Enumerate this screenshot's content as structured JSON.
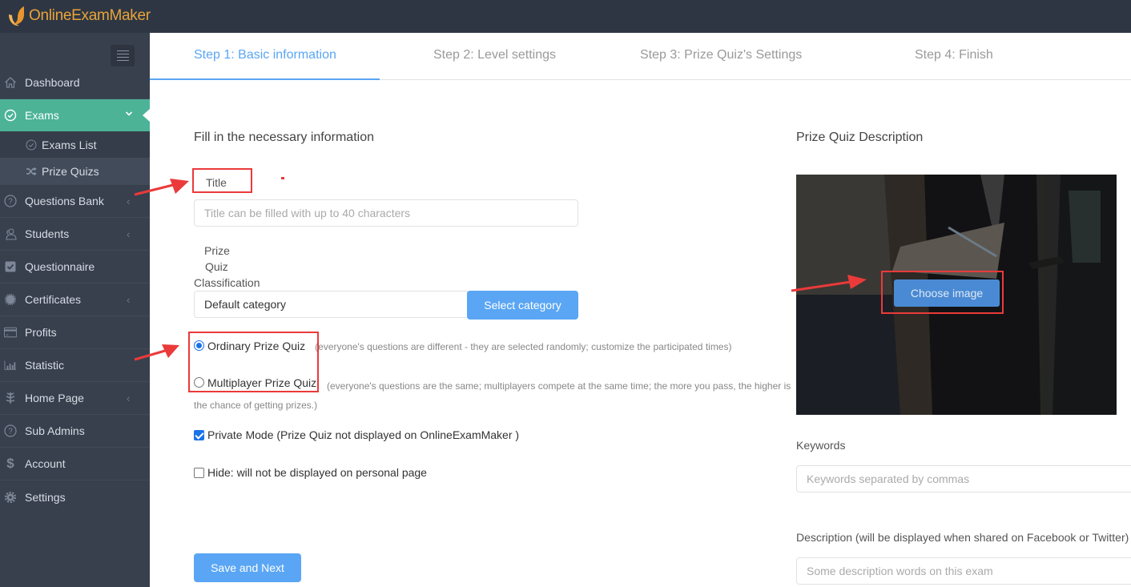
{
  "app": {
    "brand": "OnlineExamMaker",
    "accent_color": "#4cb397",
    "primary_color": "#5aa6f4"
  },
  "sidebar": {
    "toggle_icon": "hamburger-icon",
    "items": [
      {
        "label": "Dashboard",
        "icon": "home-icon",
        "has_chevron": false
      },
      {
        "label": "Exams",
        "icon": "check-circle-icon",
        "has_chevron": true,
        "active": true,
        "children": [
          {
            "label": "Exams List",
            "icon": "check-circle-icon"
          },
          {
            "label": "Prize Quizs",
            "icon": "shuffle-icon",
            "current": true
          }
        ]
      },
      {
        "label": "Questions Bank",
        "icon": "question-circle-icon",
        "has_chevron": true
      },
      {
        "label": "Students",
        "icon": "users-icon",
        "has_chevron": true
      },
      {
        "label": "Questionnaire",
        "icon": "checkbox-icon",
        "has_chevron": false
      },
      {
        "label": "Certificates",
        "icon": "certificate-icon",
        "has_chevron": true
      },
      {
        "label": "Profits",
        "icon": "credit-card-icon",
        "has_chevron": false
      },
      {
        "label": "Statistic",
        "icon": "bar-chart-icon",
        "has_chevron": false
      },
      {
        "label": "Home Page",
        "icon": "leaf-icon",
        "has_chevron": true
      },
      {
        "label": "Sub Admins",
        "icon": "question-circle-icon",
        "has_chevron": false
      },
      {
        "label": "Account",
        "icon": "dollar-icon",
        "has_chevron": false
      },
      {
        "label": "Settings",
        "icon": "gear-icon",
        "has_chevron": false
      }
    ]
  },
  "steps": [
    {
      "label": "Step 1: Basic information",
      "active": true
    },
    {
      "label": "Step 2: Level settings",
      "active": false
    },
    {
      "label": "Step 3:  Prize Quiz's Settings",
      "active": false
    },
    {
      "label": "Step 4: Finish",
      "active": false
    }
  ],
  "form": {
    "section_title": "Fill in the necessary information",
    "title_label": "Title",
    "title_placeholder": "Title can be filled with up to 40 characters",
    "title_value": "",
    "classification_label_line1": "Prize",
    "classification_label_line2": "Quiz",
    "classification_label_line3": "Classification",
    "category_value": "Default category",
    "select_category_button": "Select category",
    "quiz_type": {
      "selected": "ordinary",
      "options": [
        {
          "id": "ordinary",
          "label": "Ordinary Prize Quiz",
          "hint": "(everyone's questions are different - they are selected randomly; customize the participated times)"
        },
        {
          "id": "multiplayer",
          "label": "Multiplayer Prize Quiz",
          "hint": "(everyone's questions are the same; multiplayers compete at the same time; the more you pass, the higher is the chance of getting prizes.)"
        }
      ]
    },
    "private_mode": {
      "label": "Private Mode (Prize Quiz not displayed on OnlineExamMaker )",
      "checked": true
    },
    "hide": {
      "label": "Hide: will not be displayed on personal page",
      "checked": false
    },
    "save_next_button": "Save and Next"
  },
  "description_panel": {
    "title": "Prize Quiz Description",
    "choose_image_button": "Choose image",
    "keywords_label": "Keywords",
    "keywords_placeholder": "Keywords separated by commas",
    "description_label": "Description (will be displayed when shared on Facebook or Twitter)",
    "description_placeholder": "Some description words on this exam"
  },
  "annotations": {
    "highlight_color": "#ea3a3a"
  }
}
